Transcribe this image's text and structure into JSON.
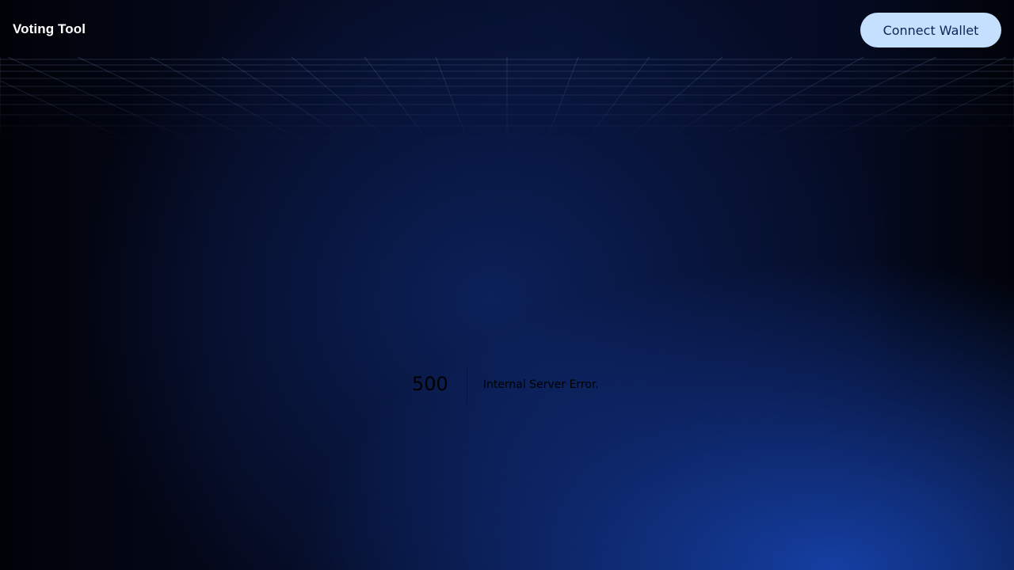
{
  "header": {
    "brand": "Voting Tool",
    "connect_label": "Connect Wallet"
  },
  "error": {
    "code": "500",
    "message": "Internal Server Error."
  },
  "colors": {
    "button_bg": "#c5e0ff",
    "button_text": "#0d2456",
    "glow": "#1642aa"
  }
}
